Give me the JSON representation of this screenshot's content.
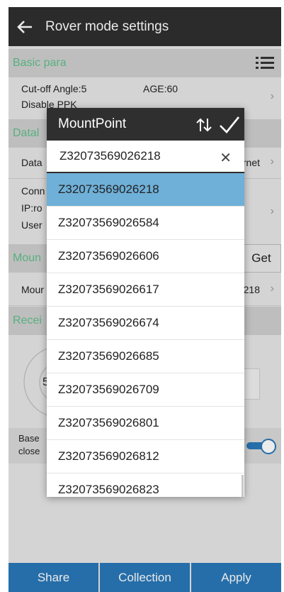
{
  "header": {
    "title": "Rover mode settings"
  },
  "basic": {
    "section_label": "Basic para",
    "cutoff": "Cut-off Angle:5",
    "age": "AGE:60",
    "ppk": "Disable PPK"
  },
  "datalink": {
    "section_label": "Datal",
    "data_label": "Data",
    "data_value": "rnet",
    "conn_l1": "Conn",
    "conn_l2": "IP:ro",
    "conn_l3": "User"
  },
  "mount": {
    "section_label": "Moun",
    "get_label": "Get",
    "row_label": "Mour",
    "row_value": "218"
  },
  "receiver": {
    "section_label": "Recei",
    "gauge_fragment": "5"
  },
  "base": {
    "line1": "Base",
    "line2": "close"
  },
  "bottom": {
    "share": "Share",
    "collection": "Collection",
    "apply": "Apply"
  },
  "dialog": {
    "title": "MountPoint",
    "search_value": "Z32073569026218",
    "items": [
      "Z32073569026218",
      "Z32073569026584",
      "Z32073569026606",
      "Z32073569026617",
      "Z32073569026674",
      "Z32073569026685",
      "Z32073569026709",
      "Z32073569026801",
      "Z32073569026812",
      "Z32073569026823"
    ],
    "selected_index": 0
  },
  "colors": {
    "accent_green": "#5fbf8a",
    "selected_blue": "#6fb0d8",
    "button_blue": "#2a78b8",
    "toggle_blue": "#2a78b8"
  }
}
